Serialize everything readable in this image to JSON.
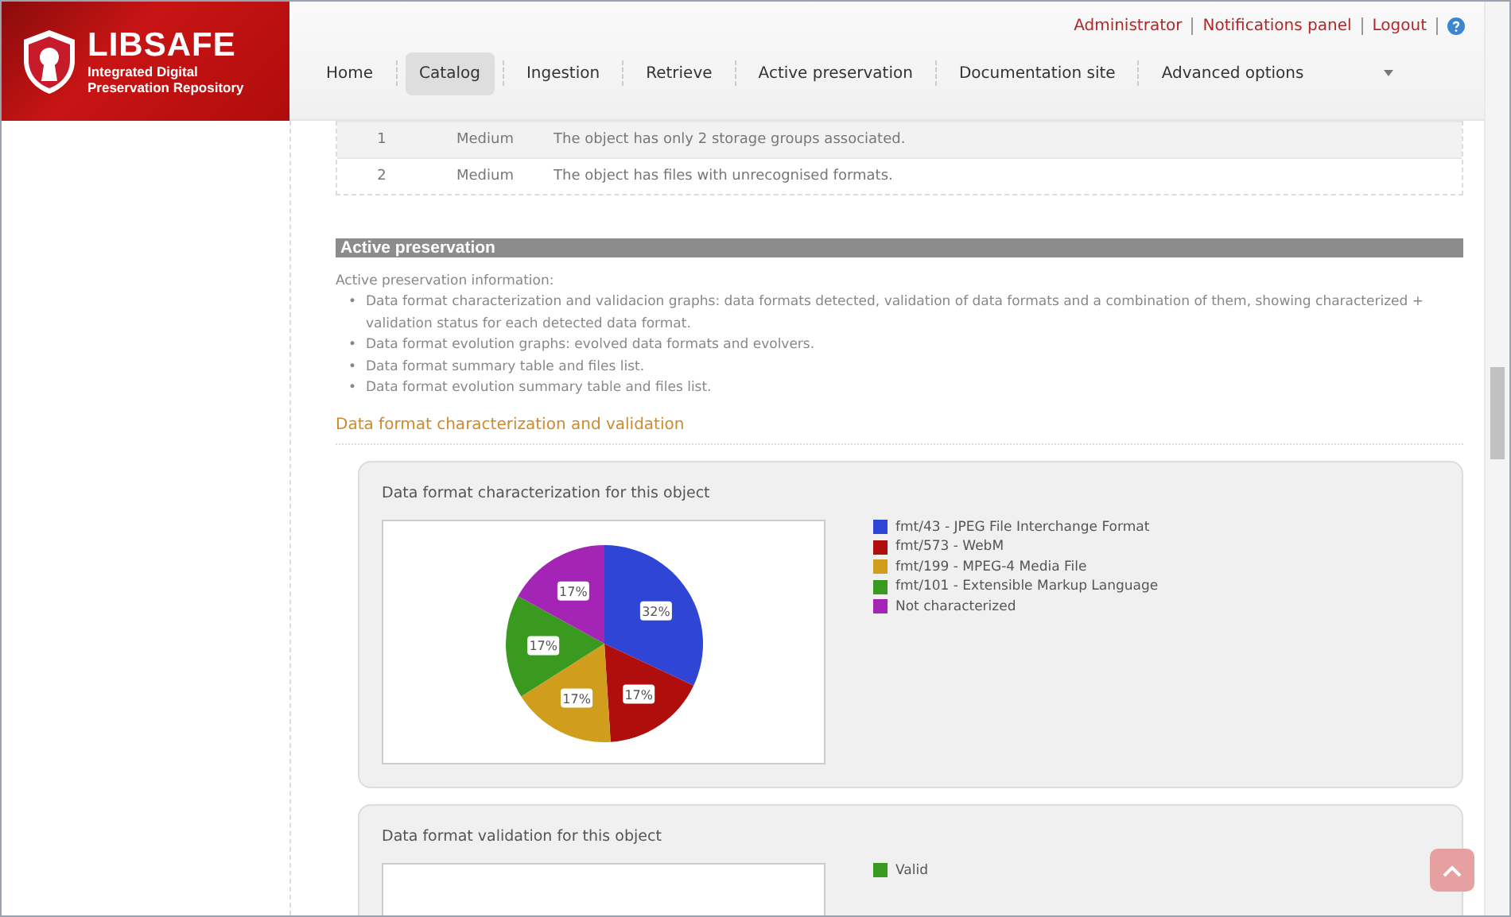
{
  "header": {
    "logo": {
      "name": "LIBSAFE",
      "subtitle": "Integrated Digital Preservation Repository"
    },
    "user_links": [
      {
        "label": "Administrator"
      },
      {
        "label": "Notifications panel"
      },
      {
        "label": "Logout"
      }
    ],
    "nav": [
      {
        "label": "Home",
        "selected": false,
        "dropdown": false
      },
      {
        "label": "Catalog",
        "selected": true,
        "dropdown": false
      },
      {
        "label": "Ingestion",
        "selected": false,
        "dropdown": false
      },
      {
        "label": "Retrieve",
        "selected": false,
        "dropdown": false
      },
      {
        "label": "Active preservation",
        "selected": false,
        "dropdown": false
      },
      {
        "label": "Documentation site",
        "selected": false,
        "dropdown": false
      },
      {
        "label": "Advanced options",
        "selected": false,
        "dropdown": true
      }
    ]
  },
  "issues_table": {
    "rows": [
      {
        "cells": [
          "1",
          "Medium",
          "The object has only 2 storage groups associated."
        ]
      },
      {
        "cells": [
          "2",
          "Medium",
          "The object has files with unrecognised formats."
        ]
      }
    ]
  },
  "section": {
    "title": "Active preservation",
    "intro": "Active preservation information:",
    "bullets": [
      {
        "marker": "•",
        "text": "Data format characterization and validacion graphs: data formats detected, validation of data formats and a combination of them, showing characterized + validation status for each detected data format."
      },
      {
        "marker": "•",
        "text": "Data format evolution graphs: evolved data formats and evolvers."
      },
      {
        "marker": "•",
        "text": "Data format summary table and files list."
      },
      {
        "marker": "•",
        "text": "Data format evolution summary table and files list."
      }
    ],
    "subheading": "Data format characterization and validation"
  },
  "cards": [
    {
      "title": "Data format characterization for this object",
      "legend": [
        {
          "color": "#2f45d6"
        },
        {
          "color": "#b00d0d"
        },
        {
          "color": "#d19d1d"
        },
        {
          "color": "#3a9a20"
        },
        {
          "color": "#a425b5"
        }
      ],
      "chart_data": {
        "type": "pie",
        "categories": [
          "fmt/43 - JPEG File Interchange Format",
          "fmt/573 - WebM",
          "fmt/199 - MPEG-4 Media File",
          "fmt/101 - Extensible Markup Language",
          "Not characterized"
        ],
        "values": [
          32,
          17,
          17,
          17,
          17
        ],
        "value_labels": [
          "32%",
          "17%",
          "17%",
          "17%",
          "17%"
        ]
      }
    },
    {
      "title": "Data format validation for this object",
      "legend": [
        {
          "label": "Valid",
          "color": "#3a9a20"
        }
      ]
    }
  ]
}
